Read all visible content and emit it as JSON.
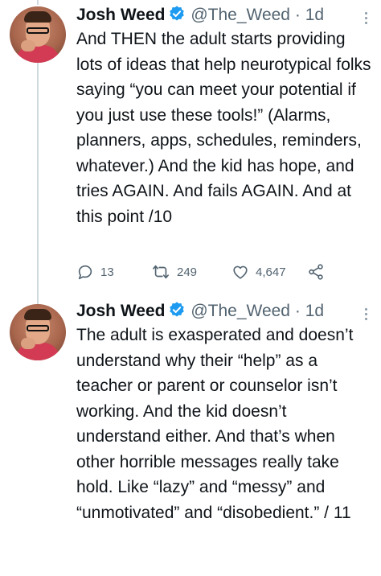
{
  "tweets": [
    {
      "author_name": "Josh Weed",
      "handle": "@The_Weed",
      "separator": "·",
      "time": "1d",
      "text": "And THEN the adult starts providing lots of ideas that help neurotypical folks saying “you can meet your potential if you just use these tools!” (Alarms, planners, apps, schedules, reminders, whatever.) And the kid has hope, and tries AGAIN. And fails AGAIN. And at this point /10",
      "replies": "13",
      "retweets": "249",
      "likes": "4,647"
    },
    {
      "author_name": "Josh Weed",
      "handle": "@The_Weed",
      "separator": "·",
      "time": "1d",
      "text": "The adult is exasperated and doesn’t understand why their “help” as a teacher or parent or counselor isn’t working. And the kid doesn’t understand either. And that’s when other horrible messages really take hold. Like “lazy” and “messy” and “unmotivated” and “disobedient.” / 11"
    }
  ],
  "colors": {
    "verified": "#1d9bf0",
    "secondary_text": "#536471",
    "thread_line": "#cfd9de"
  },
  "icons": [
    "verified-badge-icon",
    "reply-icon",
    "retweet-icon",
    "like-icon",
    "share-icon",
    "more-icon"
  ]
}
